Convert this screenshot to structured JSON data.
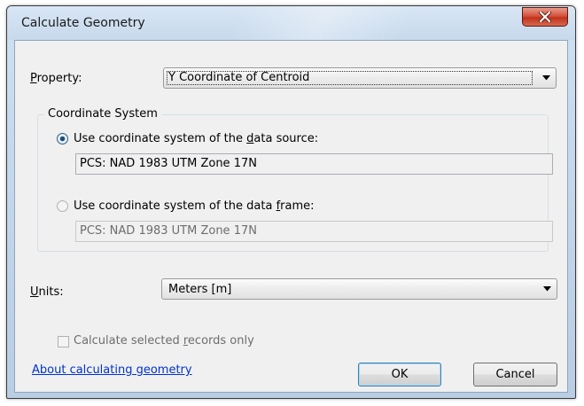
{
  "window": {
    "title": "Calculate Geometry",
    "close_label": "close"
  },
  "property": {
    "label_prefix": "",
    "label_mnemonic": "P",
    "label_rest": "roperty:",
    "selected": "Y Coordinate of Centroid"
  },
  "coordinate_system": {
    "group_title": "Coordinate System",
    "source_option": {
      "label_before": "Use coordinate system of the ",
      "label_mnemonic": "d",
      "label_after": "ata source:",
      "checked": true,
      "value": "PCS: NAD 1983 UTM Zone 17N"
    },
    "frame_option": {
      "label_before": "Use coordinate system of the data ",
      "label_mnemonic": "f",
      "label_after": "rame:",
      "checked": false,
      "value": "PCS: NAD 1983 UTM Zone 17N"
    }
  },
  "units": {
    "label_mnemonic": "U",
    "label_rest": "nits:",
    "selected": "Meters [m]"
  },
  "selected_only": {
    "label_before": "Calculate selected ",
    "label_mnemonic": "r",
    "label_after": "ecords only",
    "checked": false
  },
  "help_link": "About calculating geometry",
  "buttons": {
    "ok": "OK",
    "cancel": "Cancel"
  },
  "colors": {
    "link": "#0033cc",
    "close_button": "#c0321c",
    "dialog_face": "#f0f0f0"
  }
}
